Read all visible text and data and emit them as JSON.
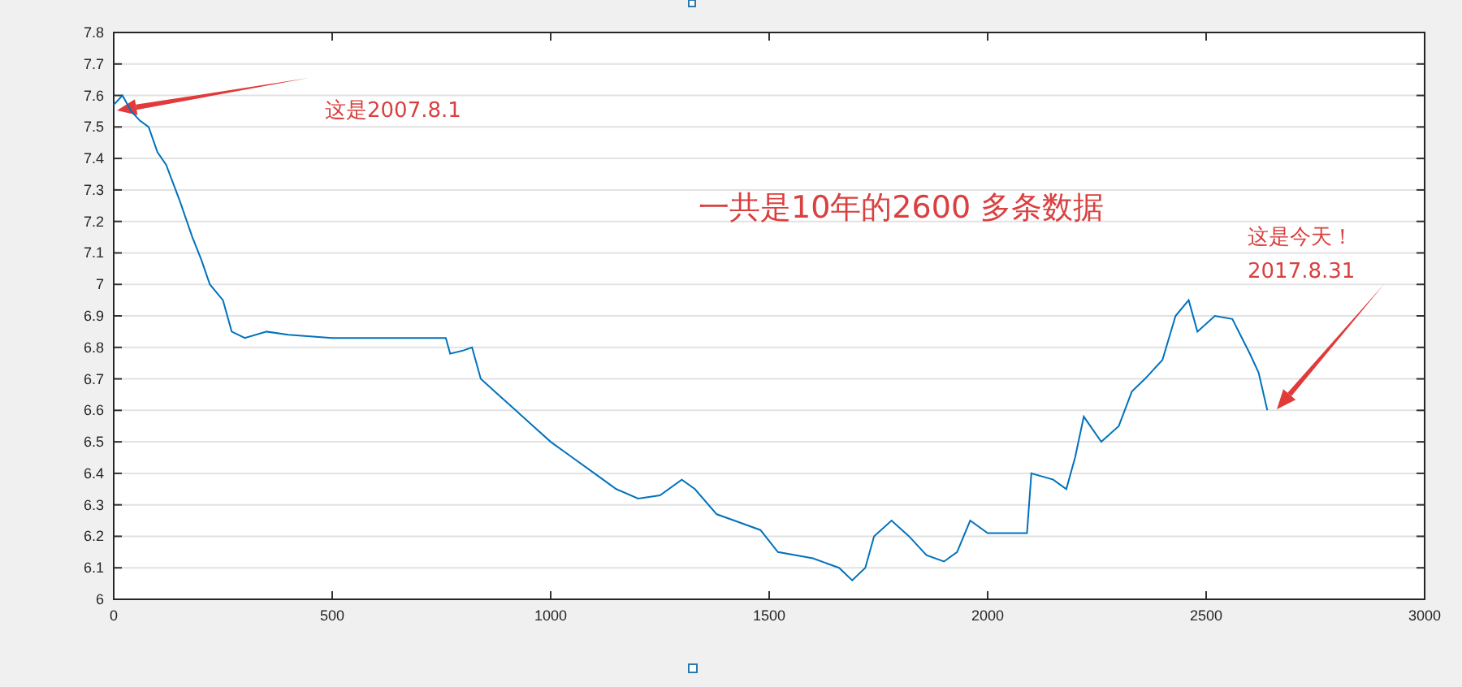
{
  "figure": {
    "chart_data": {
      "type": "line",
      "xlim": [
        0,
        3000
      ],
      "ylim": [
        6,
        7.8
      ],
      "xticks": [
        0,
        500,
        1000,
        1500,
        2000,
        2500,
        3000
      ],
      "yticks": [
        {
          "value": 6,
          "label": "6"
        },
        {
          "value": 6.1,
          "label": "6.1"
        },
        {
          "value": 6.2,
          "label": "6.2"
        },
        {
          "value": 6.3,
          "label": "6.3"
        },
        {
          "value": 6.4,
          "label": "6.4"
        },
        {
          "value": 6.5,
          "label": "6.5"
        },
        {
          "value": 6.6,
          "label": "6.6"
        },
        {
          "value": 6.7,
          "label": "6.7"
        },
        {
          "value": 6.8,
          "label": "6.8"
        },
        {
          "value": 6.9,
          "label": "6.9"
        },
        {
          "value": 7,
          "label": "7"
        },
        {
          "value": 7.1,
          "label": "7.1"
        },
        {
          "value": 7.2,
          "label": "7.2"
        },
        {
          "value": 7.3,
          "label": "7.3"
        },
        {
          "value": 7.4,
          "label": "7.4"
        },
        {
          "value": 7.5,
          "label": "7.5"
        },
        {
          "value": 7.6,
          "label": "7.6"
        },
        {
          "value": 7.7,
          "label": "7.7"
        },
        {
          "value": 7.8,
          "label": "7.8"
        }
      ],
      "x": [
        0,
        20,
        40,
        60,
        80,
        100,
        120,
        150,
        180,
        200,
        220,
        250,
        270,
        300,
        350,
        400,
        500,
        600,
        700,
        760,
        770,
        800,
        820,
        840,
        880,
        920,
        960,
        1000,
        1050,
        1100,
        1150,
        1200,
        1250,
        1300,
        1330,
        1380,
        1420,
        1480,
        1520,
        1600,
        1660,
        1690,
        1720,
        1740,
        1780,
        1820,
        1860,
        1900,
        1930,
        1960,
        2000,
        2050,
        2090,
        2100,
        2150,
        2180,
        2200,
        2220,
        2260,
        2300,
        2330,
        2360,
        2400,
        2430,
        2460,
        2480,
        2520,
        2560,
        2600,
        2620,
        2640
      ],
      "series": [
        {
          "color": "#0072bd",
          "values": [
            7.57,
            7.6,
            7.55,
            7.52,
            7.5,
            7.42,
            7.38,
            7.27,
            7.15,
            7.08,
            7.0,
            6.95,
            6.85,
            6.83,
            6.85,
            6.84,
            6.83,
            6.83,
            6.83,
            6.83,
            6.78,
            6.79,
            6.8,
            6.7,
            6.65,
            6.6,
            6.55,
            6.5,
            6.45,
            6.4,
            6.35,
            6.32,
            6.33,
            6.38,
            6.35,
            6.27,
            6.25,
            6.22,
            6.15,
            6.13,
            6.1,
            6.06,
            6.1,
            6.2,
            6.25,
            6.2,
            6.14,
            6.12,
            6.15,
            6.25,
            6.21,
            6.21,
            6.21,
            6.4,
            6.38,
            6.35,
            6.45,
            6.58,
            6.5,
            6.55,
            6.66,
            6.7,
            6.76,
            6.9,
            6.95,
            6.85,
            6.9,
            6.89,
            6.78,
            6.72,
            6.6
          ]
        }
      ],
      "grid": true,
      "annotations": [
        "这是2007.8.1",
        "一共是10年的2600 多条数据",
        "这是今天！",
        "2017.8.31"
      ]
    }
  }
}
